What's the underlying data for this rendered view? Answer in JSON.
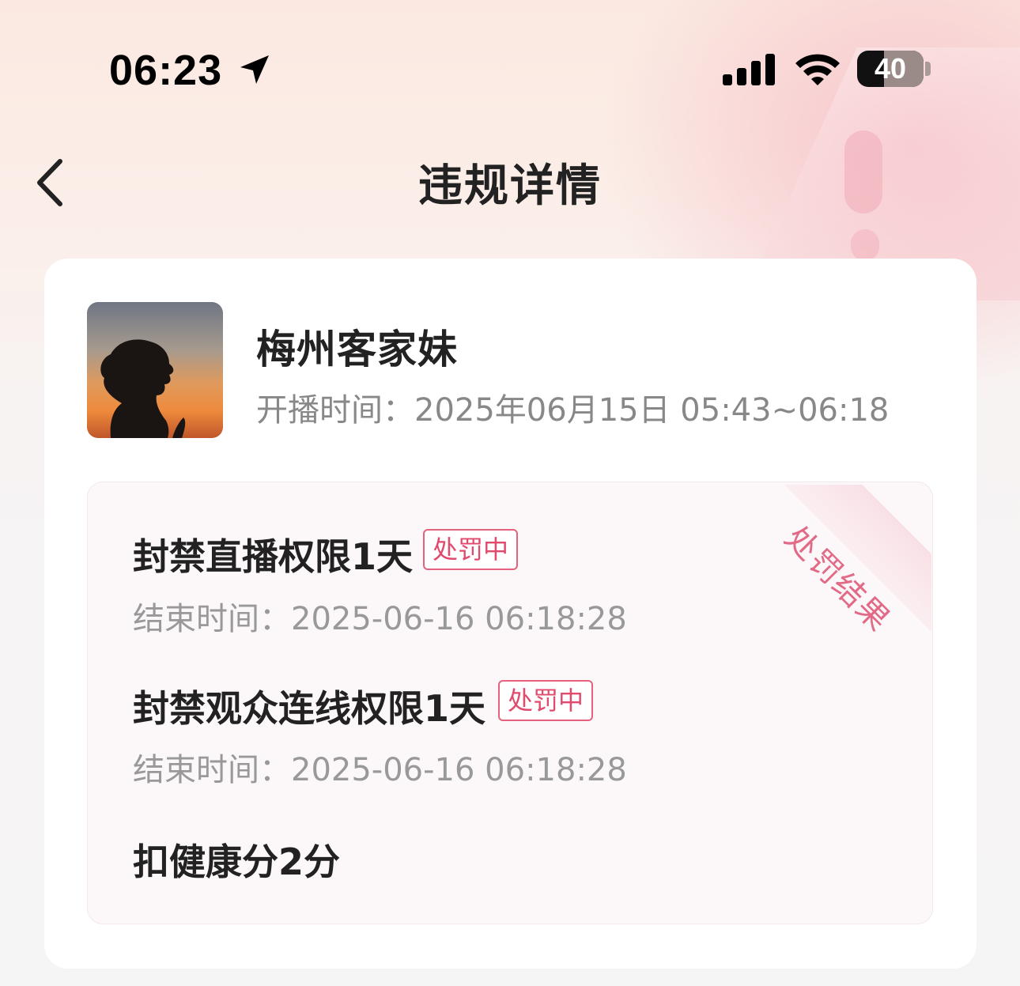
{
  "status_bar": {
    "time": "06:23",
    "battery": "40",
    "icons": [
      "location-arrow-icon",
      "signal-icon",
      "wifi-icon",
      "battery-icon"
    ]
  },
  "nav": {
    "title": "违规详情",
    "back_icon": "chevron-left-icon"
  },
  "profile": {
    "name": "梅州客家妹",
    "live_time": "开播时间：2025年06月15日 05:43~06:18"
  },
  "penalty_panel": {
    "ribbon": "处罚结果",
    "items": [
      {
        "title": "封禁直播权限1天",
        "status": "处罚中",
        "end_time": "结束时间：2025-06-16 06:18:28"
      },
      {
        "title": "封禁观众连线权限1天",
        "status": "处罚中",
        "end_time": "结束时间：2025-06-16 06:18:28"
      }
    ],
    "health_score": "扣健康分2分"
  },
  "colors": {
    "accent": "#e04a6c",
    "text_primary": "#222222",
    "text_secondary": "#999999"
  }
}
